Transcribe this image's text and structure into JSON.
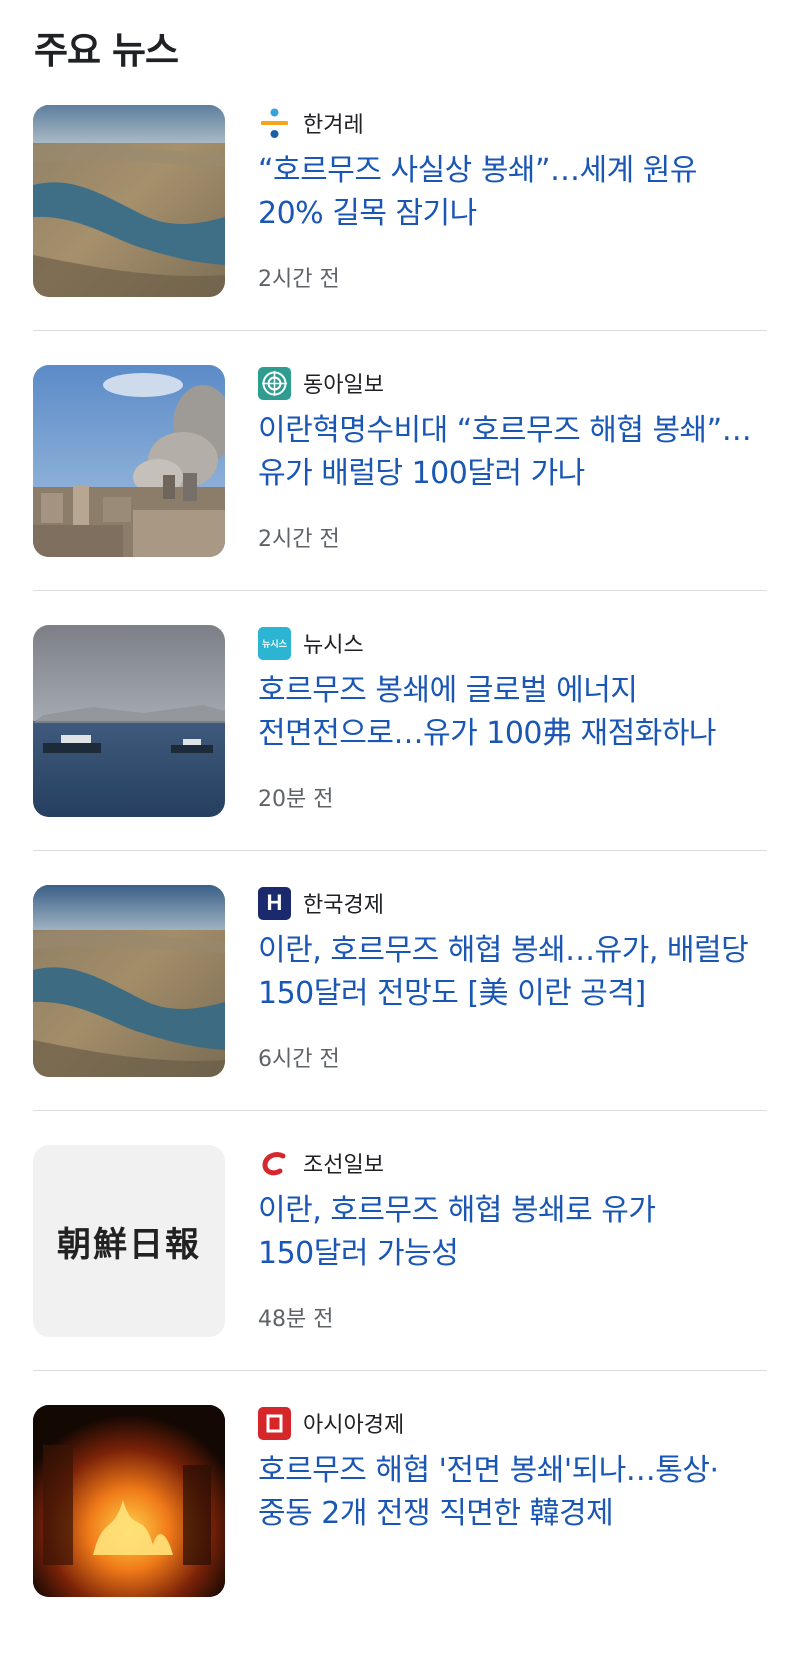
{
  "section": {
    "title": "주요 뉴스"
  },
  "articles": [
    {
      "source": "한겨레",
      "headline": "“호르무즈 사실상 봉쇄”…세계 원유 20% 길목 잠기나",
      "time": "2시간 전"
    },
    {
      "source": "동아일보",
      "headline": "이란혁명수비대 “호르무즈 해협 봉쇄”…유가 배럴당 100달러 가나",
      "time": "2시간 전"
    },
    {
      "source": "뉴시스",
      "logo_text": "뉴시스",
      "headline": "호르무즈 봉쇄에 글로벌 에너지 전면전으로…유가 100弗 재점화하나",
      "time": "20분 전"
    },
    {
      "source": "한국경제",
      "logo_text": "H",
      "headline": "이란, 호르무즈 해협 봉쇄…유가, 배럴당 150달러 전망도 [美 이란 공격]",
      "time": "6시간 전"
    },
    {
      "source": "조선일보",
      "thumb_text": "朝鮮日報",
      "headline": "이란, 호르무즈 해협 봉쇄로 유가 150달러 가능성",
      "time": "48분 전"
    },
    {
      "source": "아시아경제",
      "headline": "호르무즈 해협 '전면 봉쇄'되나…통상·중동 2개 전쟁 직면한 韓경제"
    }
  ],
  "colors": {
    "headline": "#1a57b5",
    "source": "#202124",
    "time": "#5f6368",
    "divider": "#dadce0",
    "logo_donga": "#2e9c8f",
    "logo_newsis": "#2bb5d3",
    "logo_hankyung": "#1a2a6c",
    "logo_chosun": "#d6262e",
    "logo_asiae": "#d5262a"
  }
}
